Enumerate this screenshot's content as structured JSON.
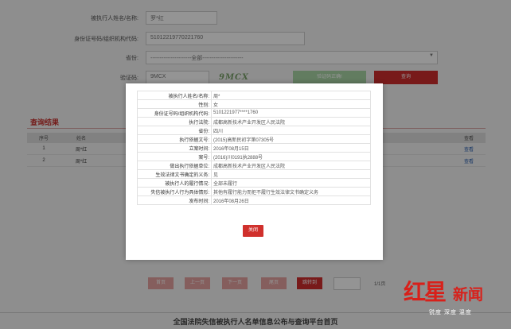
{
  "form": {
    "name_label": "被执行人姓名/名称:",
    "name_value": "罗*红",
    "id_label": "身份证号码/组织机构代码:",
    "id_value": "51012219770221760",
    "province_label": "省份:",
    "province_value": "----------------------全部----------------------",
    "captcha_label": "验证码:",
    "captcha_input": "9MCX",
    "captcha_image_text": "9MCX",
    "captcha_tip": "验证码正确!",
    "search_button": "查询"
  },
  "results": {
    "title": "查询结果",
    "headers": [
      "序号",
      "姓名",
      "",
      "",
      "",
      "",
      "查看"
    ],
    "rows": [
      {
        "index": "1",
        "name": "周*红",
        "view": "查看"
      },
      {
        "index": "2",
        "name": "周*红",
        "view": "查看"
      }
    ]
  },
  "pager": {
    "first": "首页",
    "prev": "上一页",
    "next": "下一页",
    "last": "尾页",
    "goto": "跳转到",
    "page_info": "1/1页"
  },
  "footer": {
    "title": "全国法院失信被执行人名单信息公布与查询平台首页"
  },
  "modal": {
    "rows": [
      {
        "label": "被执行人姓名/名称:",
        "value": "周*"
      },
      {
        "label": "性别:",
        "value": "女"
      },
      {
        "label": "身份证号码/组织机构代码:",
        "value": "5101221977****1760"
      },
      {
        "label": "执行法院:",
        "value": "成都高新技术产业开发区人民法院"
      },
      {
        "label": "省份:",
        "value": "四川"
      },
      {
        "label": "执行依据文号:",
        "value": "(2015)高新民初字第07305号"
      },
      {
        "label": "立案时间:",
        "value": "2016年08月15日"
      },
      {
        "label": "案号:",
        "value": "(2016)川0191执2888号"
      },
      {
        "label": "做出执行依据单位:",
        "value": "成都高新技术产业开发区人民法院"
      },
      {
        "label": "生效法律文书确定的义务:",
        "value": "见"
      },
      {
        "label": "被执行人的履行情况:",
        "value": "全部未履行"
      },
      {
        "label": "失信被执行人行为具体情形:",
        "value": "其他有履行能力而拒不履行生效法律文书确定义务"
      },
      {
        "label": "发布时间:",
        "value": "2016年08月26日"
      }
    ],
    "close_button": "关闭"
  },
  "watermark": {
    "logo_text": "红星",
    "news_text": "新闻",
    "tagline": "锐度 深度 温度"
  },
  "colors": {
    "accent_red": "#cf2d2d",
    "success_green": "#a9d6a6",
    "pager_pink": "#e6a3a0"
  }
}
